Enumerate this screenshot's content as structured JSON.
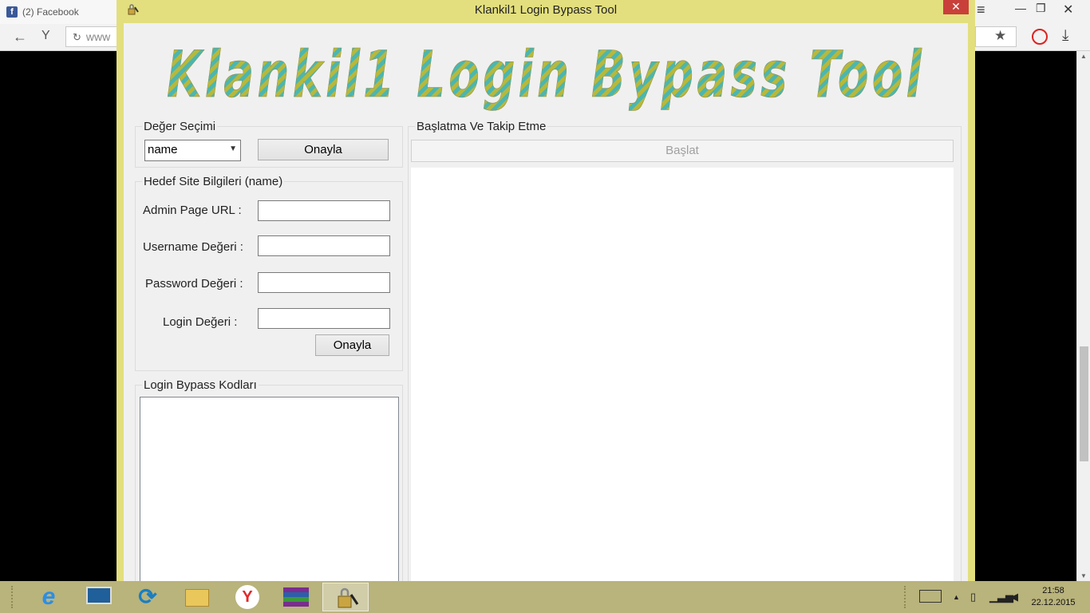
{
  "browser": {
    "tab_label": "(2) Facebook",
    "tab_icon": "facebook-icon",
    "address_partial": "www",
    "colors": {
      "chrome": "#f2f2f2",
      "record": "#dd2222"
    }
  },
  "window": {
    "title": "Klankil1 Login Bypass Tool",
    "close_glyph": "✕",
    "colors": {
      "frame": "#e3df7e",
      "close": "#c9403a",
      "client": "#f0f0f0"
    }
  },
  "logo": {
    "text": "Klankil1 Login Bypass Tool",
    "colors": {
      "stripe_a": "#b8b83a",
      "stripe_b": "#4bb6b0"
    }
  },
  "value_selection": {
    "legend": "Değer Seçimi",
    "selected": "name",
    "confirm_label": "Onayla"
  },
  "target_site": {
    "legend": "Hedef Site Bilgileri (name)",
    "admin_url_label": "Admin Page URL :",
    "username_label": "Username Değeri :",
    "password_label": "Password Değeri :",
    "login_label": "Login Değeri :",
    "admin_url_value": "",
    "username_value": "",
    "password_value": "",
    "login_value": "",
    "confirm_label": "Onayla"
  },
  "bypass_codes": {
    "legend": "Login Bypass Kodları",
    "value": ""
  },
  "start_track": {
    "legend": "Başlatma Ve Takip Etme",
    "start_label": "Başlat",
    "output": ""
  },
  "taskbar": {
    "items": [
      "internet-explorer-icon",
      "lenovo-monitor-icon",
      "refresh-app-icon",
      "file-explorer-icon",
      "yandex-browser-icon",
      "winrar-icon",
      "lock-tool-icon"
    ],
    "active_index": 6,
    "clock_time": "21:58",
    "clock_date": "22.12.2015"
  }
}
